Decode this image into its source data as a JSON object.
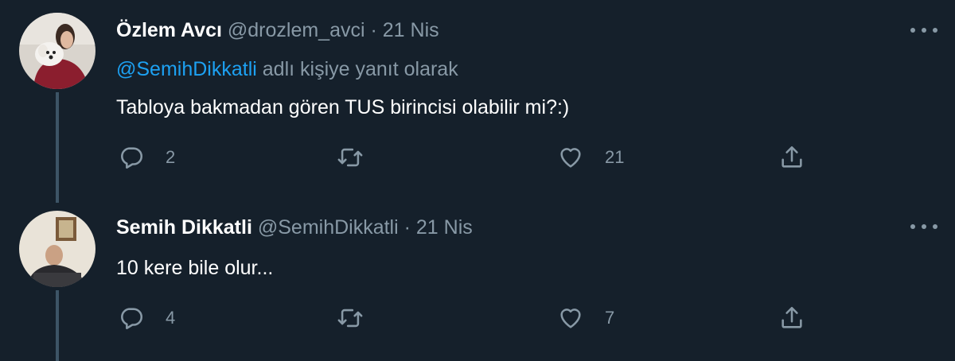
{
  "tweets": [
    {
      "display_name": "Özlem Avcı",
      "handle": "@drozlem_avci",
      "separator": "·",
      "date": "21 Nis",
      "reply_prefix_mention": "@SemihDikkatli",
      "reply_suffix": "adlı kişiye yanıt olarak",
      "text": "Tabloya bakmadan gören TUS birincisi olabilir mi?:)",
      "reply_count": "2",
      "like_count": "21"
    },
    {
      "display_name": "Semih Dikkatli",
      "handle": "@SemihDikkatli",
      "separator": "·",
      "date": "21 Nis",
      "text": "10 kere bile olur...",
      "reply_count": "4",
      "like_count": "7"
    }
  ],
  "icons": {
    "reply": "reply-icon",
    "retweet": "retweet-icon",
    "like": "heart-icon",
    "share": "share-icon",
    "more": "more-icon"
  },
  "colors": {
    "background": "#15202b",
    "secondary_text": "#8899a6",
    "link": "#1da1f2",
    "thread_line": "#3d5466"
  }
}
